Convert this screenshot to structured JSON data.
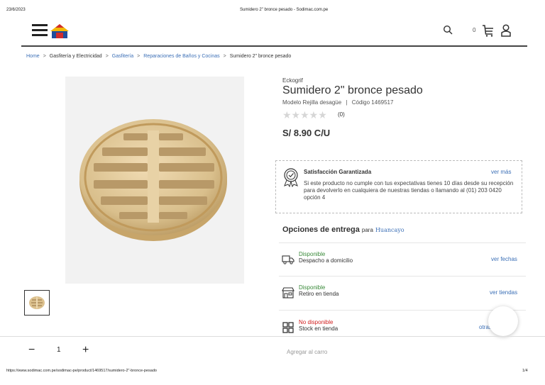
{
  "print_header": {
    "date": "23/6/2023",
    "page_title": "Sumidero 2\" bronce pesado - Sodimac.com.pe"
  },
  "header": {
    "cart_count": "0",
    "icons": [
      "menu-icon",
      "store-logo",
      "search-icon",
      "cart-icon",
      "user-icon"
    ]
  },
  "breadcrumb": [
    {
      "label": "Home",
      "link": true
    },
    {
      "label": "Gasfitería y Electricidad",
      "link": false
    },
    {
      "label": "Gasfitería",
      "link": true
    },
    {
      "label": "Reparaciones de Baños y Cocinas",
      "link": true
    },
    {
      "label": "Sumidero 2\" bronce pesado",
      "link": false
    }
  ],
  "product": {
    "brand": "Eckogrif",
    "name": "Sumidero 2\" bronce pesado",
    "model": "Modelo Rejilla desagüe",
    "separator": "|",
    "code": "Código 1469517",
    "stars": "★★★★★",
    "rating_count": "(0)",
    "price": "S/ 8.90 C/U"
  },
  "guarantee": {
    "title": "Satisfacción Garantizada",
    "link": "ver más",
    "text": "Si este producto no cumple con tus expectativas tienes 10 días desde su recepción para devolverlo en cualquiera de nuestras tiendas o llamando al (01) 203 0420 opción 4"
  },
  "delivery": {
    "title": "Opciones de entrega",
    "para": "para",
    "city": "Huancayo",
    "options": [
      {
        "status": "Disponible",
        "label": "Despacho a domicilio",
        "link": "ver fechas",
        "available": true
      },
      {
        "status": "Disponible",
        "label": "Retiro en tienda",
        "link": "ver tiendas",
        "available": true
      },
      {
        "status": "No disponible",
        "label": "Stock en tienda",
        "link": "otras tiendas",
        "available": false
      }
    ]
  },
  "cart_bar": {
    "minus": "−",
    "quantity": "1",
    "plus": "+",
    "add_label": "Agregar al carro"
  },
  "footer": {
    "url": "https://www.sodimac.com.pe/sodimac-pe/product/1469517/sumidero-2\"-bronce-pesado",
    "page": "1/4"
  },
  "colors": {
    "link": "#3b6fb6",
    "available": "#3a8a3a",
    "unavailable": "#d01f1f"
  }
}
